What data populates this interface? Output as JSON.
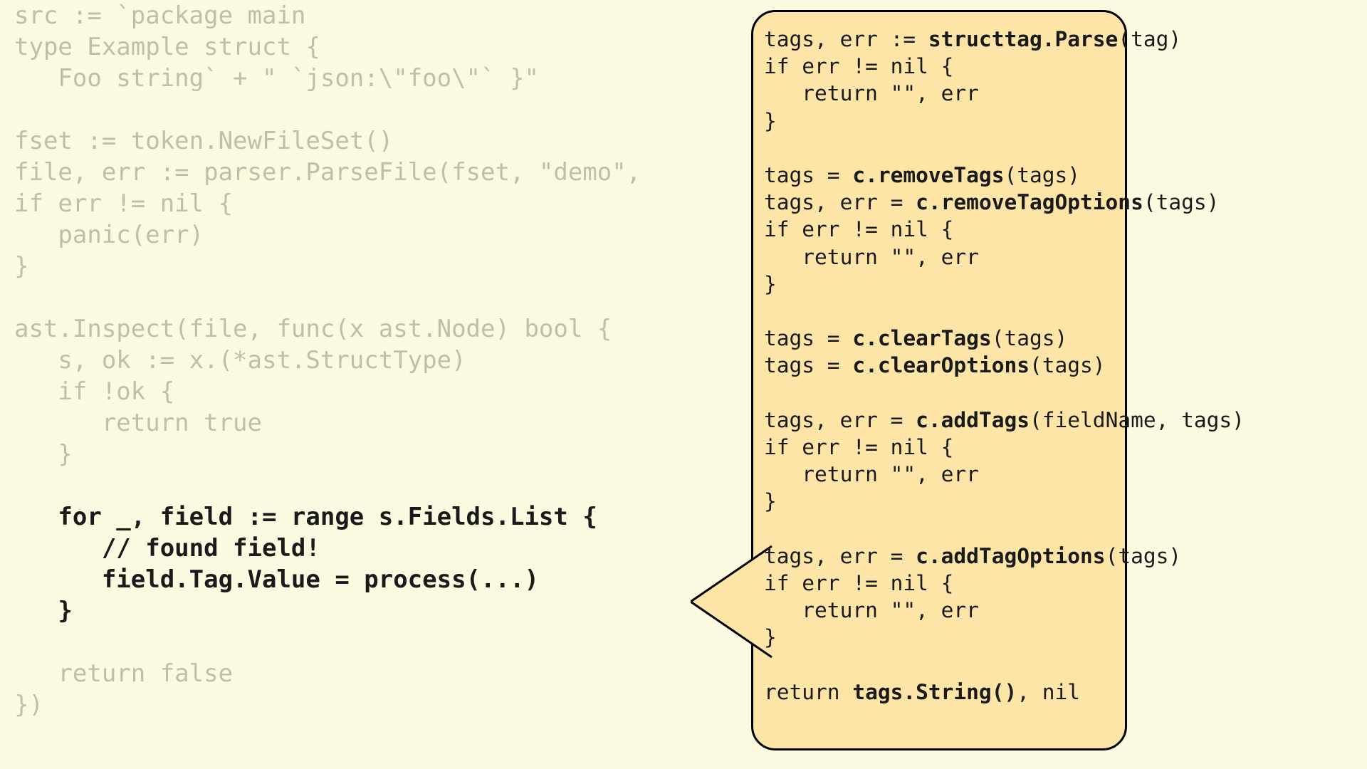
{
  "left": {
    "l01": "src := `package main",
    "l02": "type Example struct {",
    "l03": "   Foo string` + \" `json:\\\"foo\\\"` }\"",
    "l04": "",
    "l05": "fset := token.NewFileSet()",
    "l06": "file, err := parser.ParseFile(fset, \"demo\",",
    "l07": "if err != nil {",
    "l08": "   panic(err)",
    "l09": "}",
    "l10": "",
    "l11": "ast.Inspect(file, func(x ast.Node) bool {",
    "l12": "   s, ok := x.(*ast.StructType)",
    "l13": "   if !ok {",
    "l14": "      return true",
    "l15": "   }",
    "l16": "",
    "l17": "   for _, field := range s.Fields.List {",
    "l18": "      // found field!",
    "l19": "      field.Tag.Value = process(...)",
    "l20": "   }",
    "l21": "",
    "l22": "   return false",
    "l23": "})"
  },
  "right": {
    "r01a": "tags, err := ",
    "r01b": "structtag.Parse",
    "r01c": "(tag)",
    "r02": "if err != nil {",
    "r03": "   return \"\", err",
    "r04": "}",
    "r05": "",
    "r06a": "tags = ",
    "r06b": "c.removeTags",
    "r06c": "(tags)",
    "r07a": "tags, err = ",
    "r07b": "c.removeTagOptions",
    "r07c": "(tags)",
    "r08": "if err != nil {",
    "r09": "   return \"\", err",
    "r10": "}",
    "r11": "",
    "r12a": "tags = ",
    "r12b": "c.clearTags",
    "r12c": "(tags)",
    "r13a": "tags = ",
    "r13b": "c.clearOptions",
    "r13c": "(tags)",
    "r14": "",
    "r15a": "tags, err = ",
    "r15b": "c.addTags",
    "r15c": "(fieldName, tags)",
    "r16": "if err != nil {",
    "r17": "   return \"\", err",
    "r18": "}",
    "r19": "",
    "r20a": "tags, err = ",
    "r20b": "c.addTagOptions",
    "r20c": "(tags)",
    "r21": "if err != nil {",
    "r22": "   return \"\", err",
    "r23": "}",
    "r24": "",
    "r25a": "return ",
    "r25b": "tags.String()",
    "r25c": ", nil"
  }
}
